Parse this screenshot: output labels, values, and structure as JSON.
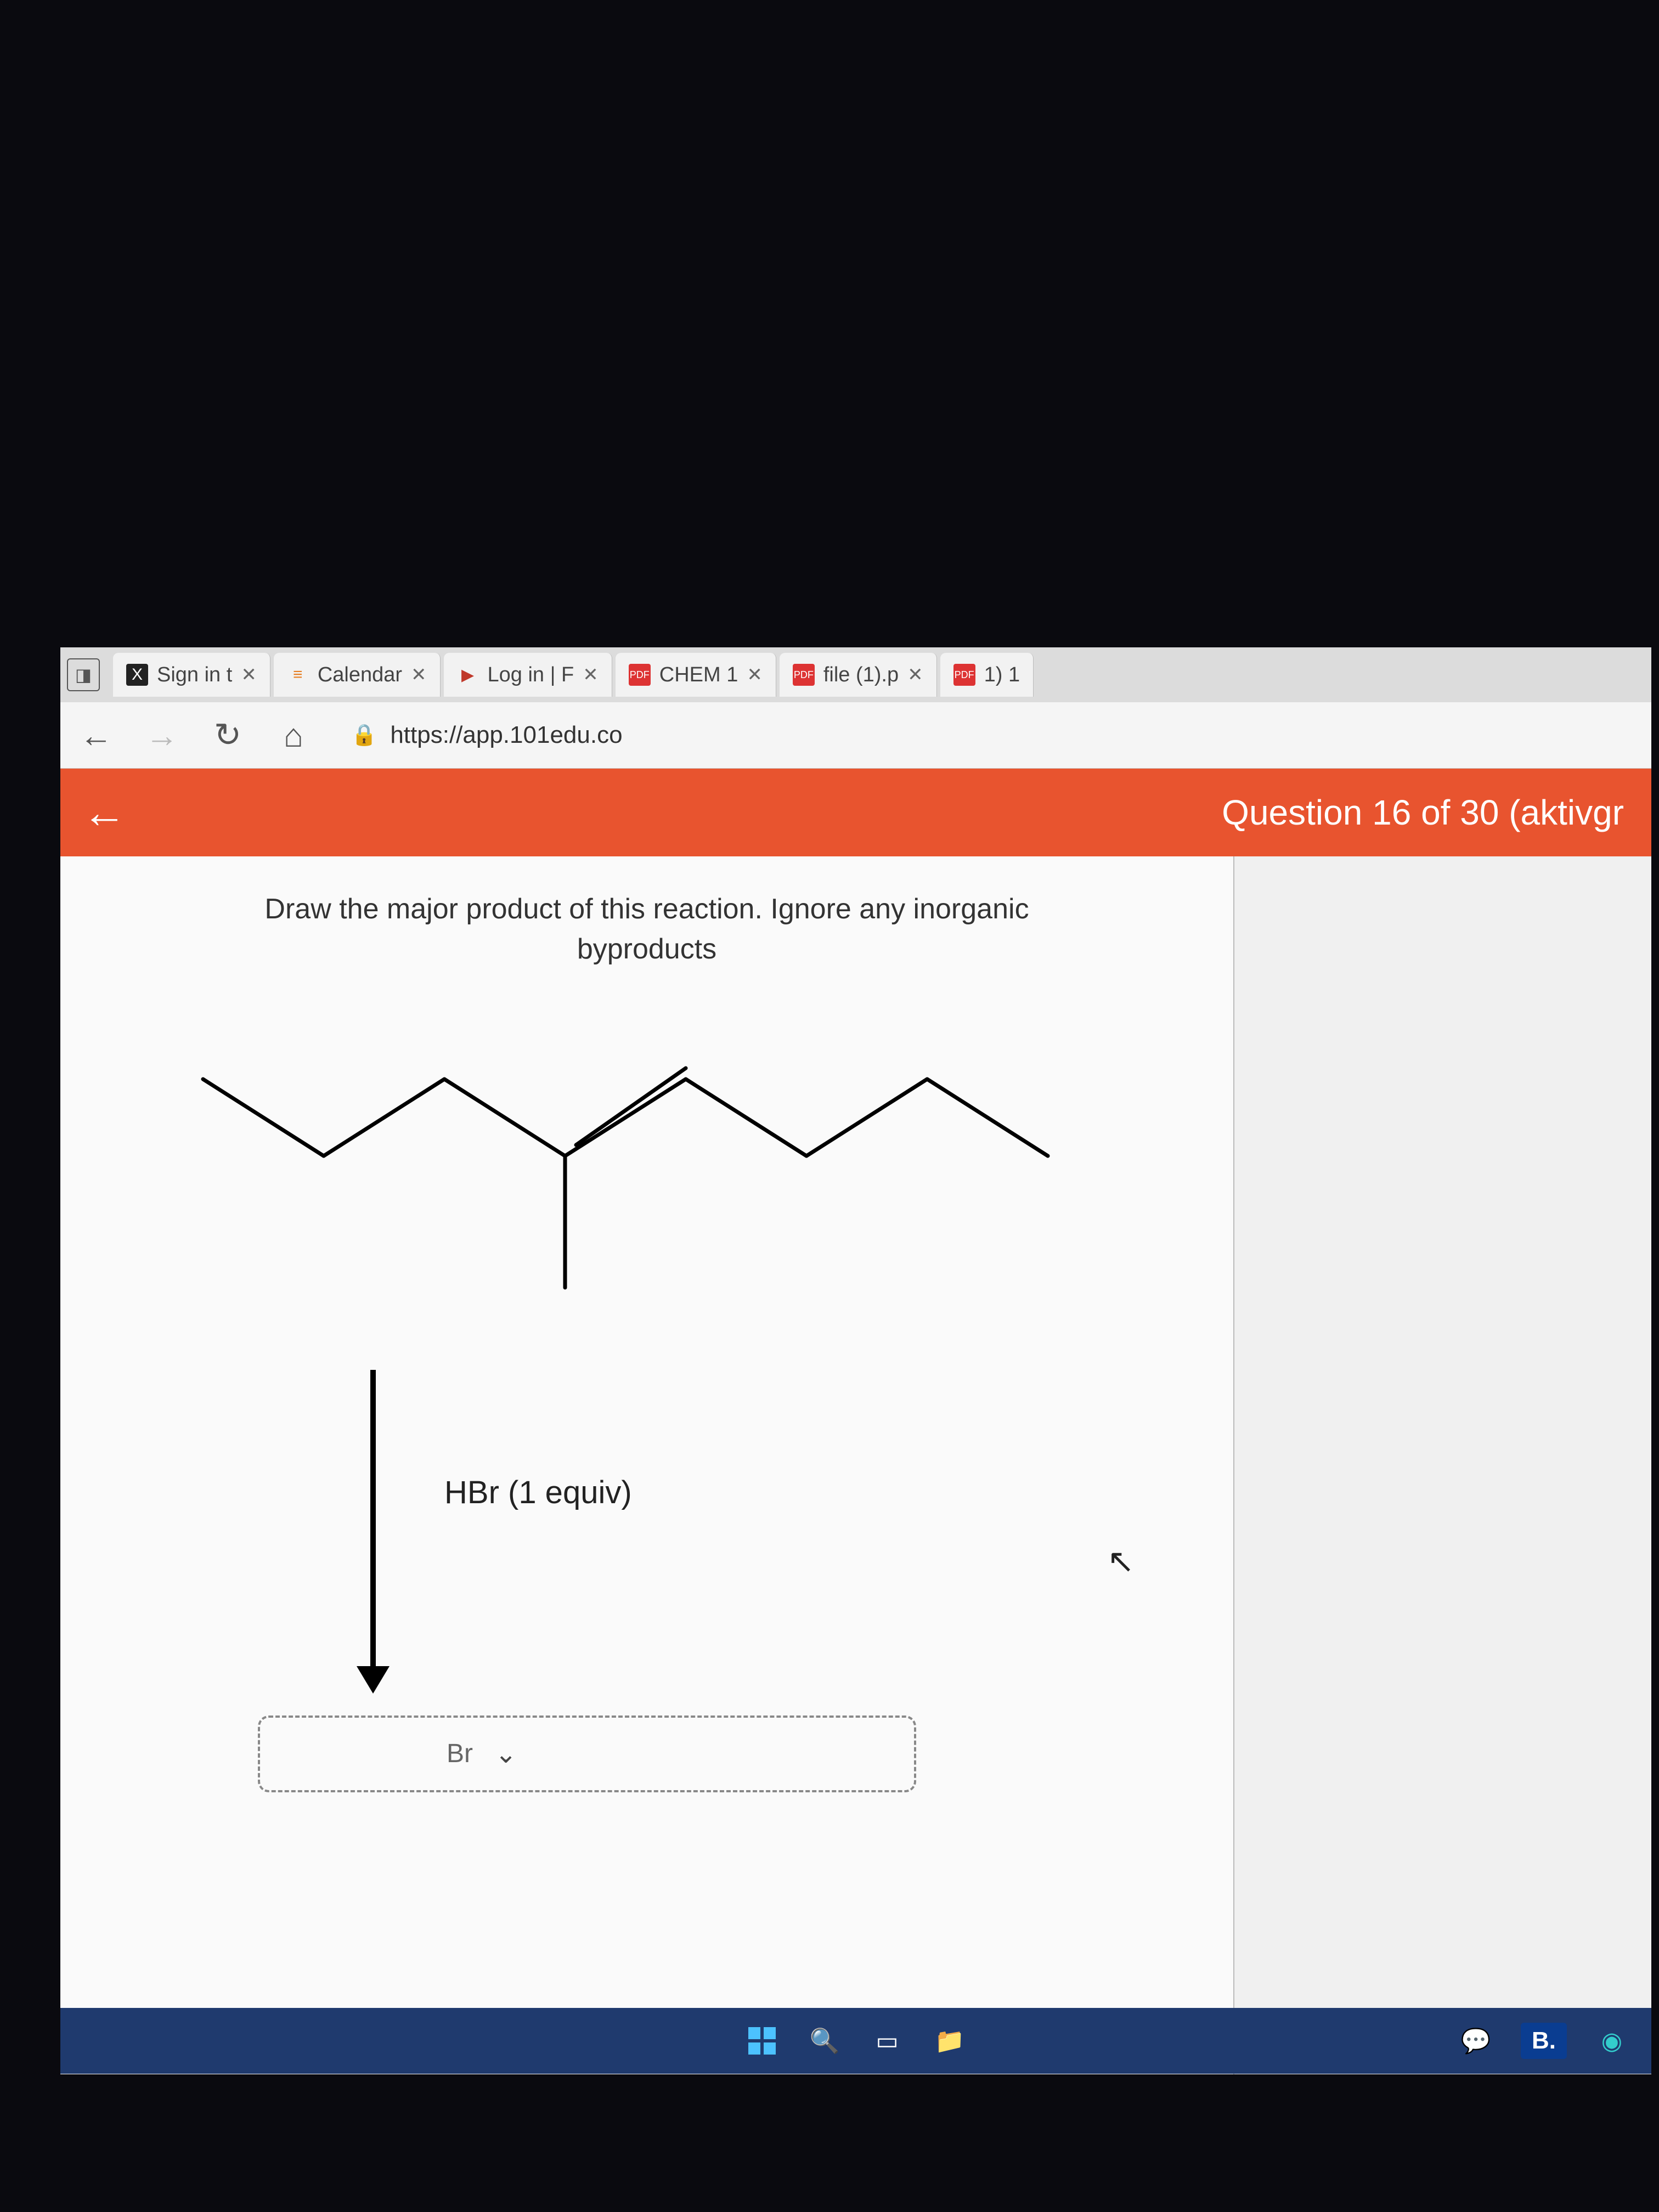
{
  "browser": {
    "tabs": [
      {
        "icon": "X",
        "label": "Sign in t"
      },
      {
        "icon": "≡",
        "label": "Calendar"
      },
      {
        "icon": "▶",
        "label": "Log in | F"
      },
      {
        "icon": "PDF",
        "label": "CHEM 1"
      },
      {
        "icon": "PDF",
        "label": "file (1).p"
      },
      {
        "icon": "PDF",
        "label": "1) 1"
      }
    ],
    "nav": {
      "back": "←",
      "forward": "→",
      "reload": "↻",
      "home": "⌂"
    },
    "url": "https://app.101edu.co",
    "lock": "🔒"
  },
  "header": {
    "back": "←",
    "title": "Question 16 of 30 (aktivgr"
  },
  "question": {
    "prompt_line1": "Draw the major product of this reaction. Ignore any inorganic",
    "prompt_line2": "byproducts",
    "reagent": "HBr (1 equiv)",
    "dropdown_label": "Br",
    "dropdown_caret": "⌄"
  },
  "taskbar": {
    "b_label": "B."
  }
}
